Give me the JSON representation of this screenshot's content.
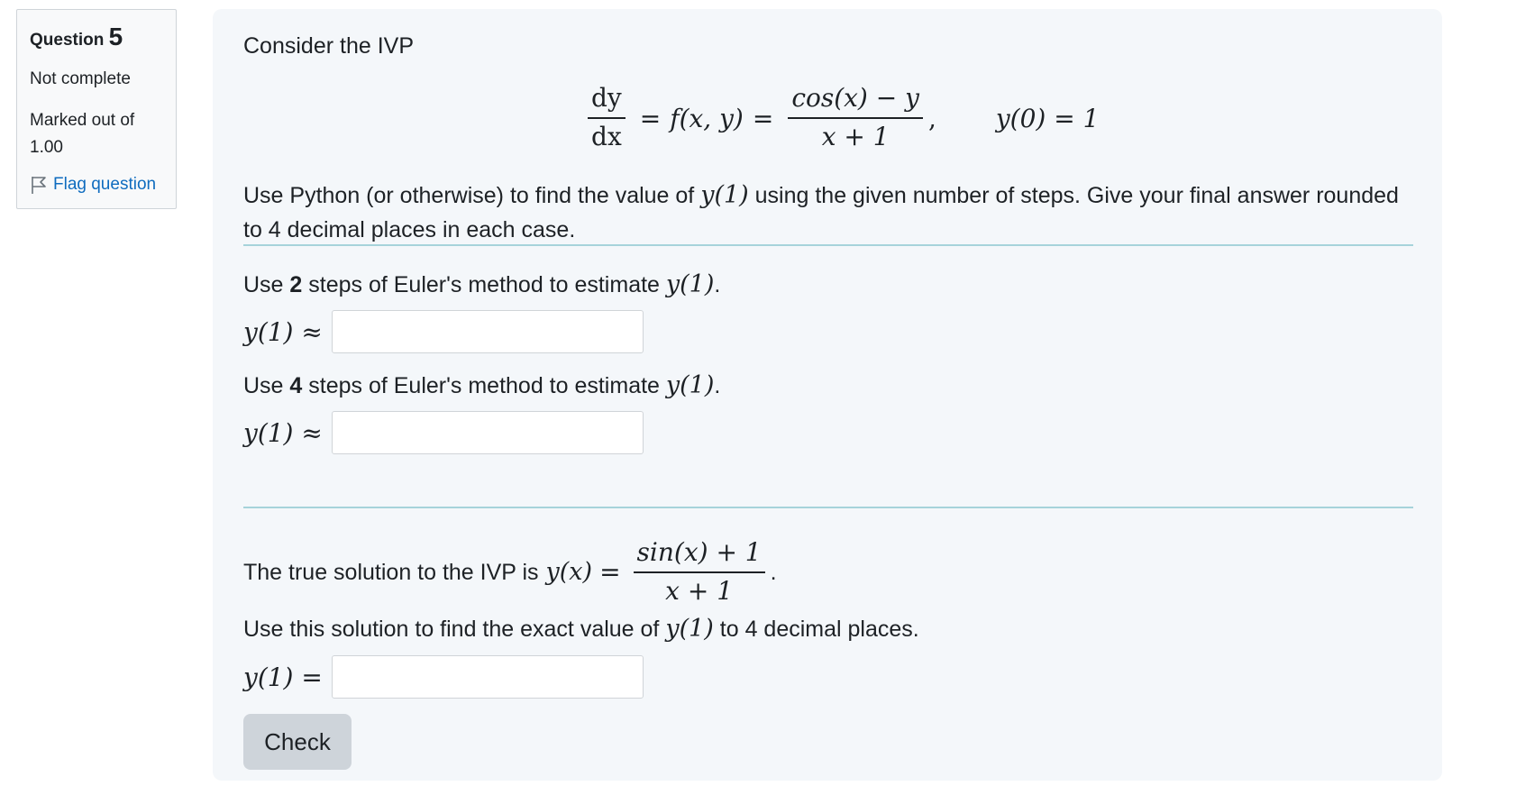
{
  "info": {
    "question_label": "Question",
    "question_number": "5",
    "state": "Not complete",
    "grade_line1": "Marked out of",
    "grade_line2": "1.00",
    "flag_label": "Flag question"
  },
  "question": {
    "intro": "Consider the IVP",
    "ode": {
      "lhs_num": "dy",
      "lhs_den": "dx",
      "mid": "f(x, y)",
      "rhs_num": "cos(x) − y",
      "rhs_den": "x + 1",
      "initial_condition": "y(0) = 1"
    },
    "instructions_part1": "Use Python (or otherwise) to find the value of ",
    "instructions_math": "y(1)",
    "instructions_part2": " using the given number of steps. Give your final answer rounded to 4 decimal places in each case.",
    "part_a": {
      "prefix": "Use ",
      "steps": "2",
      "suffix": " steps of Euler's method to estimate ",
      "math": "y(1)",
      "end": ".",
      "answer_label": "y(1) ≈",
      "answer_value": ""
    },
    "part_b": {
      "prefix": "Use ",
      "steps": "4",
      "suffix": " steps of Euler's method to estimate ",
      "math": "y(1)",
      "end": ".",
      "answer_label": "y(1) ≈",
      "answer_value": ""
    },
    "true_solution": {
      "prefix": "The true solution to the IVP is ",
      "lhs": "y(x)",
      "num": "sin(x) + 1",
      "den": "x + 1",
      "end": "."
    },
    "part_c": {
      "prefix": "Use this solution to find the exact value of ",
      "math": "y(1)",
      "suffix": " to 4 decimal places.",
      "answer_label": "y(1) =",
      "answer_value": ""
    },
    "check_label": "Check"
  }
}
